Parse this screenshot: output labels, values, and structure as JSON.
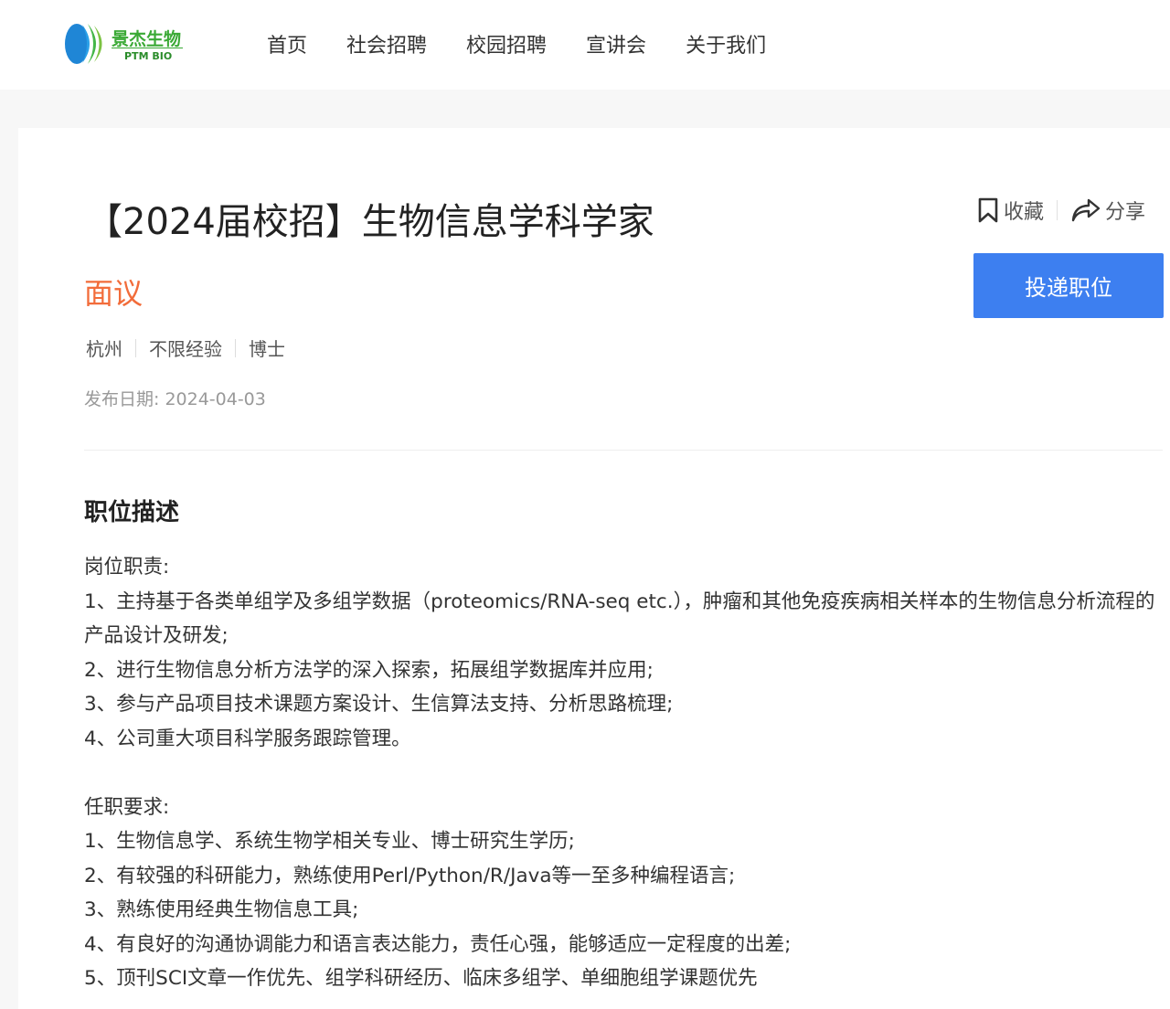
{
  "header": {
    "logo_cn": "景杰生物",
    "logo_en": "PTM BIO",
    "nav": [
      "首页",
      "社会招聘",
      "校园招聘",
      "宣讲会",
      "关于我们"
    ]
  },
  "job": {
    "title": "【2024届校招】生物信息学科学家",
    "salary": "面议",
    "tags": [
      "杭州",
      "不限经验",
      "博士"
    ],
    "post_date": "发布日期: 2024-04-03"
  },
  "actions": {
    "favorite_label": "收藏",
    "share_label": "分享",
    "apply_label": "投递职位"
  },
  "description": {
    "section_title": "职位描述",
    "duties_heading": "岗位职责:",
    "duties": [
      "1、主持基于各类单组学及多组学数据（proteomics/RNA-seq etc.），肿瘤和其他免疫疾病相关样本的生物信息分析流程的产品设计及研发;",
      "2、进行生物信息分析方法学的深入探索，拓展组学数据库并应用;",
      "3、参与产品项目技术课题方案设计、生信算法支持、分析思路梳理;",
      "4、公司重大项目科学服务跟踪管理。"
    ],
    "requirements_heading": "任职要求:",
    "requirements": [
      "1、生物信息学、系统生物学相关专业、博士研究生学历;",
      "2、有较强的科研能力，熟练使用Perl/Python/R/Java等一至多种编程语言;",
      "3、熟练使用经典生物信息工具;",
      "4、有良好的沟通协调能力和语言表达能力，责任心强，能够适应一定程度的出差;",
      "5、顶刊SCI文章一作优先、组学科研经历、临床多组学、单细胞组学课题优先"
    ]
  },
  "colors": {
    "accent_blue": "#3d7ff0",
    "salary_orange": "#f26c3a",
    "logo_green": "#3aa935"
  }
}
